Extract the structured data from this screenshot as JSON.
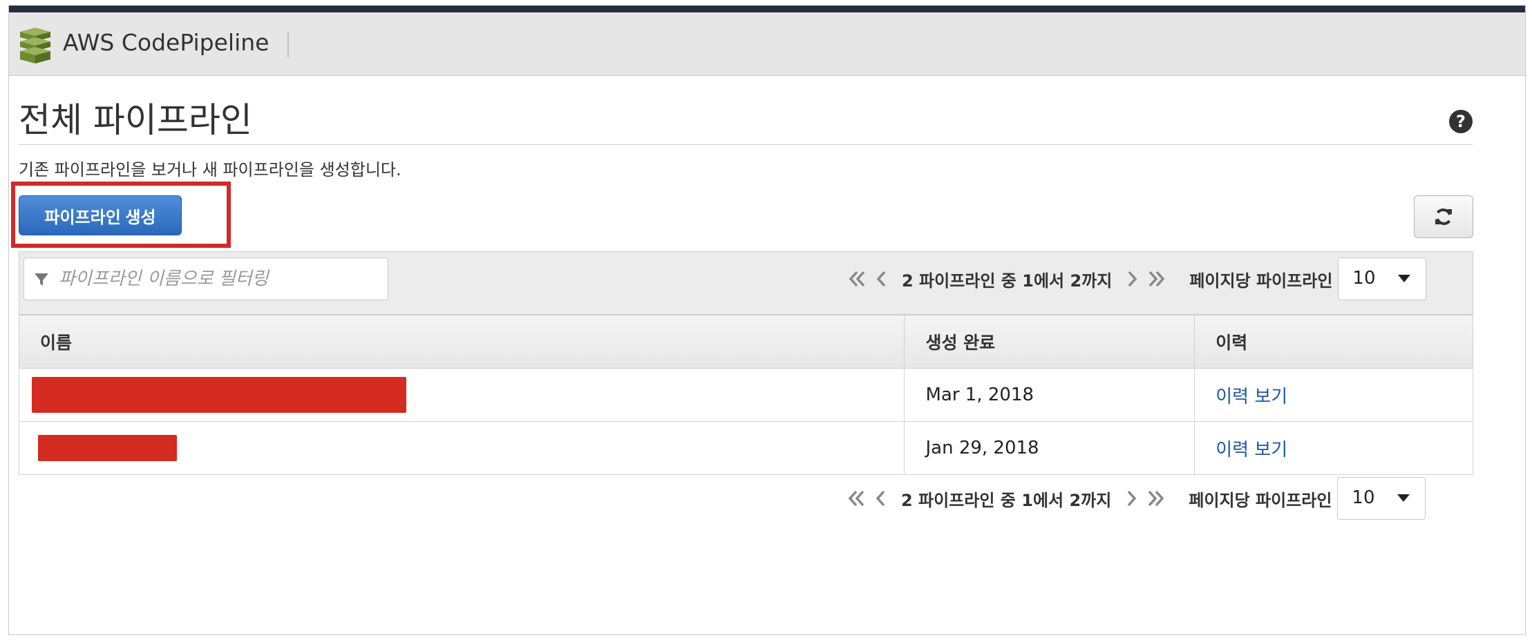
{
  "header": {
    "app_name": "AWS CodePipeline"
  },
  "page": {
    "title": "전체 파이프라인",
    "subtitle": "기존 파이프라인을 보거나 새 파이프라인을 생성합니다."
  },
  "actions": {
    "create_label": "파이프라인 생성"
  },
  "filter": {
    "placeholder": "파이프라인 이름으로 필터링"
  },
  "pagination": {
    "count_text": "2 파이프라인 중 1에서 2까지",
    "per_page_label": "페이지당 파이프라인",
    "per_page_value": "10"
  },
  "table": {
    "headers": {
      "name": "이름",
      "created": "생성 완료",
      "history": "이력"
    },
    "rows": [
      {
        "name": "",
        "created": "Mar 1, 2018",
        "history": "이력 보기"
      },
      {
        "name": "",
        "created": "Jan 29, 2018",
        "history": "이력 보기"
      }
    ]
  },
  "colors": {
    "top_bar": "#232f3e",
    "primary_button": "#2b68bd",
    "link": "#1a56a6",
    "annotation": "#d32828",
    "redaction": "#d42c20"
  },
  "icons": [
    "codepipeline-logo-icon",
    "help-icon",
    "refresh-icon",
    "filter-icon",
    "first-page-icon",
    "prev-page-icon",
    "next-page-icon",
    "last-page-icon",
    "dropdown-caret-icon"
  ]
}
